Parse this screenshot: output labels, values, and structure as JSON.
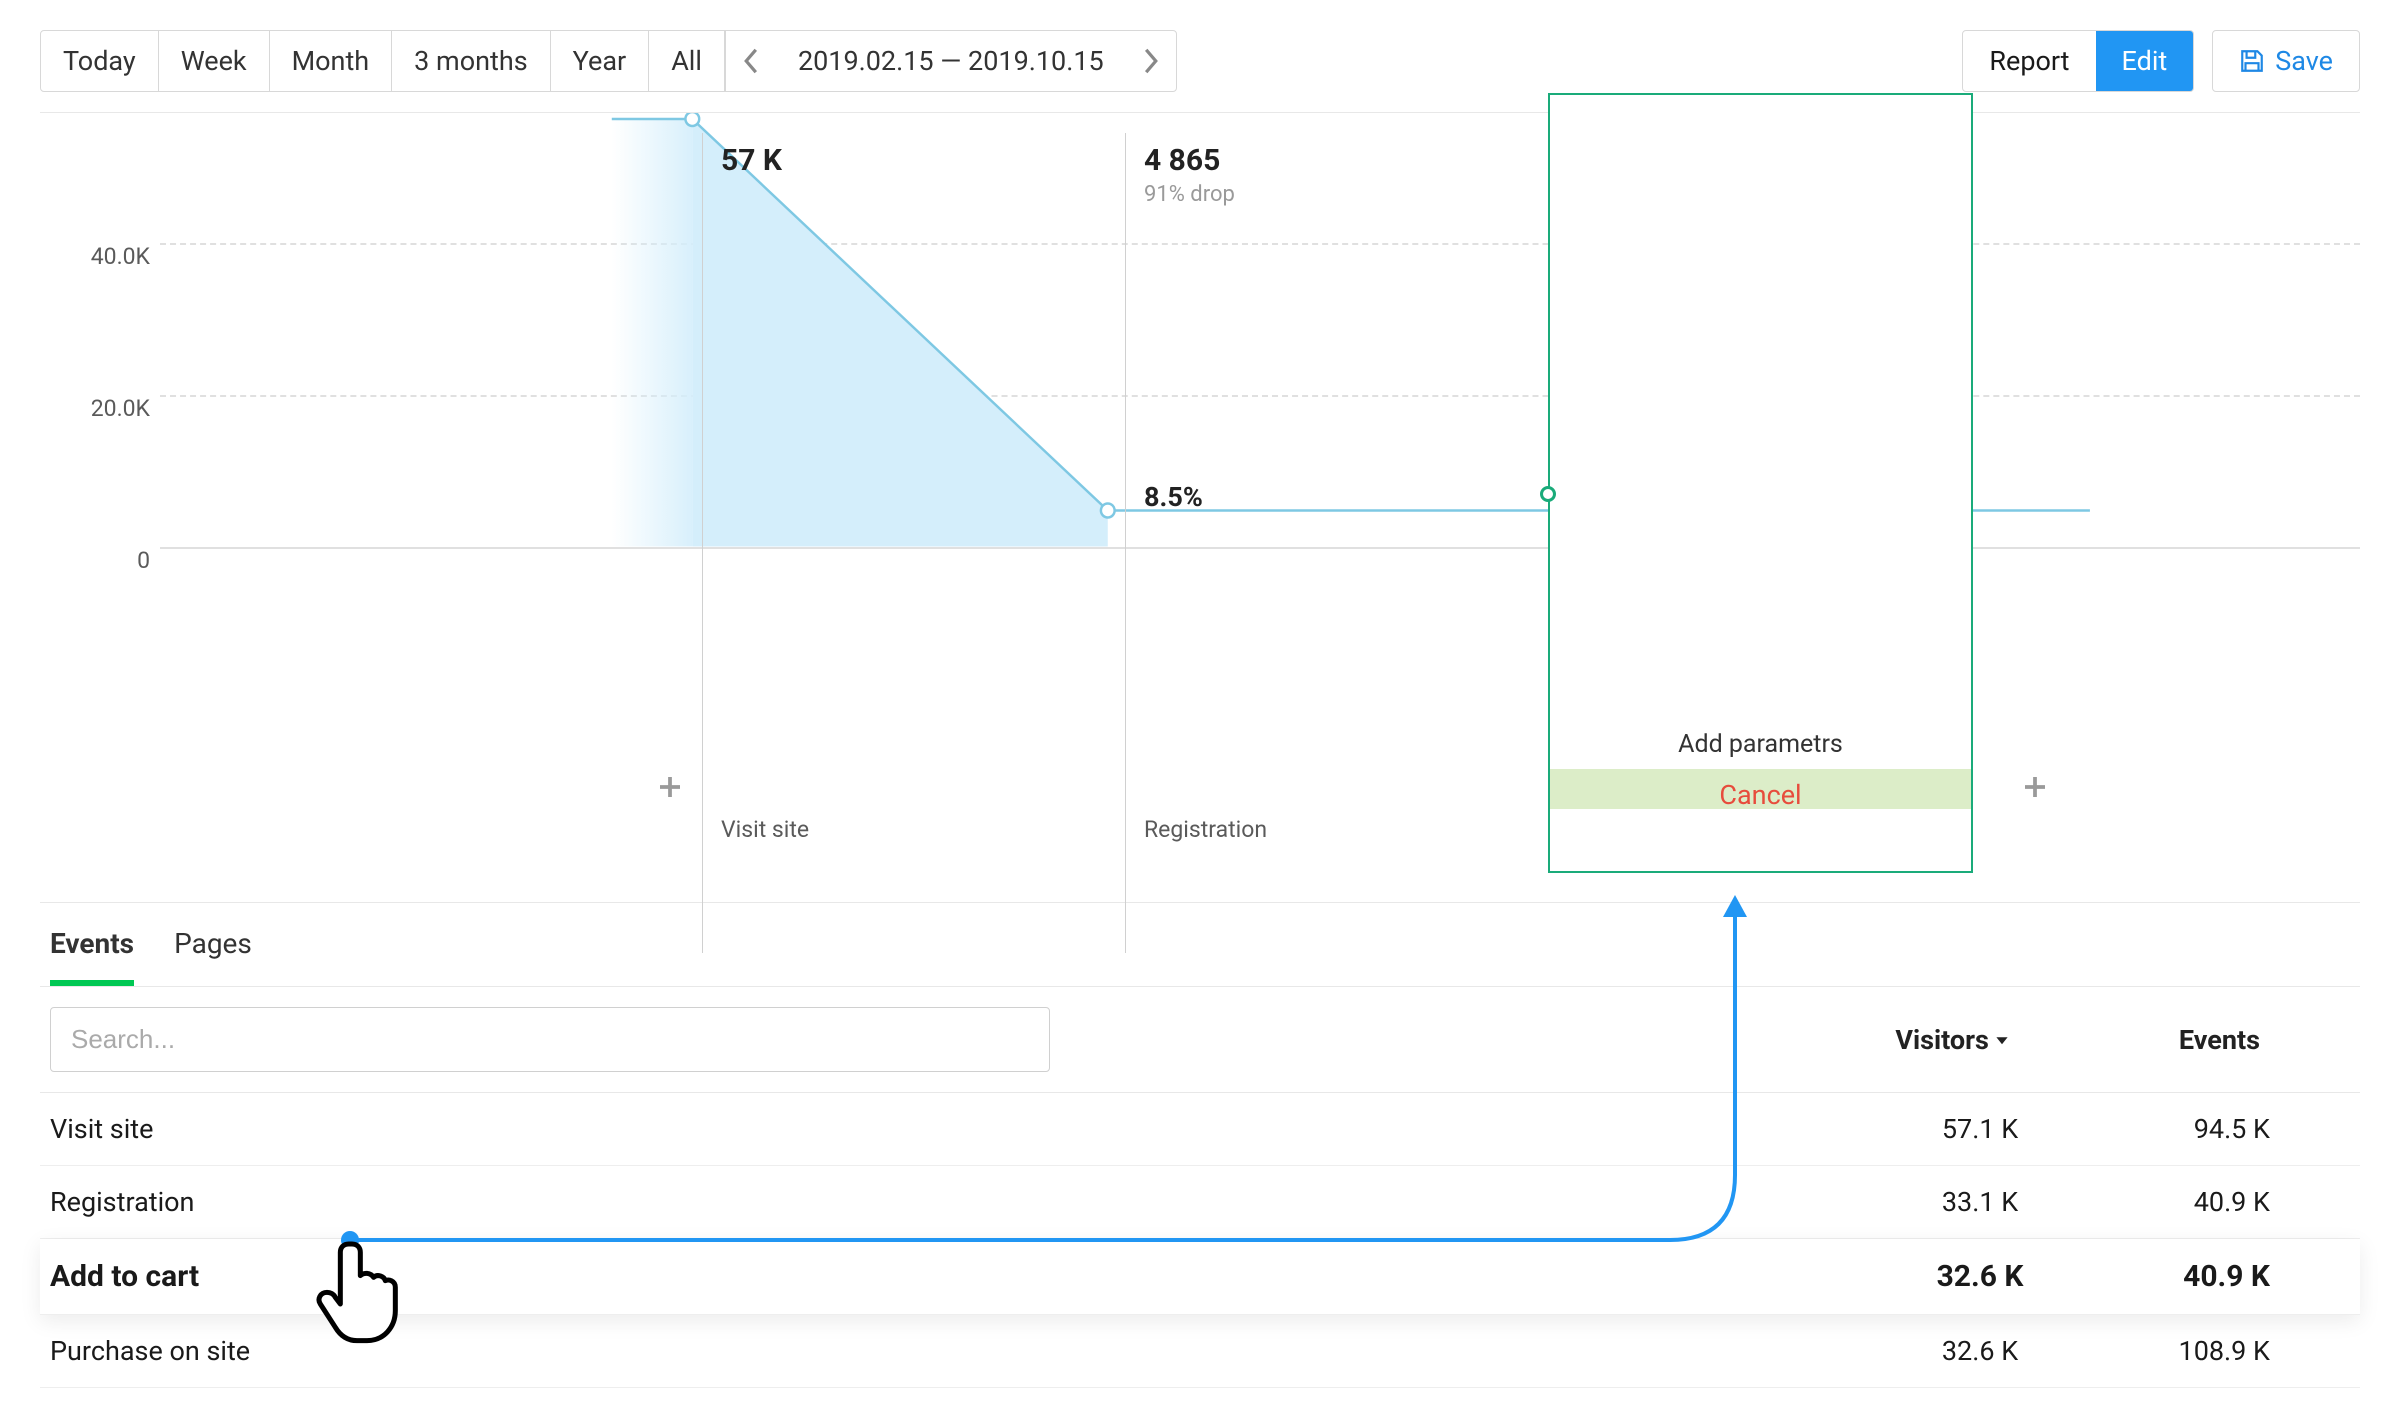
{
  "toolbar": {
    "time_buttons": [
      "Today",
      "Week",
      "Month",
      "3 months",
      "Year",
      "All"
    ],
    "date_range": "2019.02.15 — 2019.10.15",
    "report_label": "Report",
    "edit_label": "Edit",
    "save_label": "Save"
  },
  "chart_data": {
    "type": "area",
    "ylabel": "",
    "ylim": [
      0,
      57000
    ],
    "y_ticks": [
      "40.0K",
      "20.0K",
      "0"
    ],
    "stages": [
      {
        "name": "Visit site",
        "value_label": "57 K",
        "value": 57000,
        "pct_label": "",
        "drop_label": ""
      },
      {
        "name": "Registration",
        "value_label": "4 865",
        "value": 4865,
        "pct_label": "8.5%",
        "drop_label": "91% drop"
      }
    ],
    "dropzone": {
      "label": "Add parametrs",
      "cancel": "Cancel"
    }
  },
  "tabs": {
    "events": "Events",
    "pages": "Pages"
  },
  "search": {
    "placeholder": "Search..."
  },
  "columns": {
    "visitors": "Visitors",
    "events": "Events"
  },
  "rows": [
    {
      "name": "Visit site",
      "visitors": "57.1 K",
      "events": "94.5 K",
      "highlight": false
    },
    {
      "name": "Registration",
      "visitors": "33.1 K",
      "events": "40.9 K",
      "highlight": false
    },
    {
      "name": "Add to cart",
      "visitors": "32.6 K",
      "events": "40.9 K",
      "highlight": true
    },
    {
      "name": "Purchase on site",
      "visitors": "32.6 K",
      "events": "108.9 K",
      "highlight": false
    }
  ],
  "colors": {
    "accent": "#2196f3",
    "drop_border": "#1aab7a",
    "cancel": "#e74c3c",
    "tab_active": "#00c853"
  }
}
